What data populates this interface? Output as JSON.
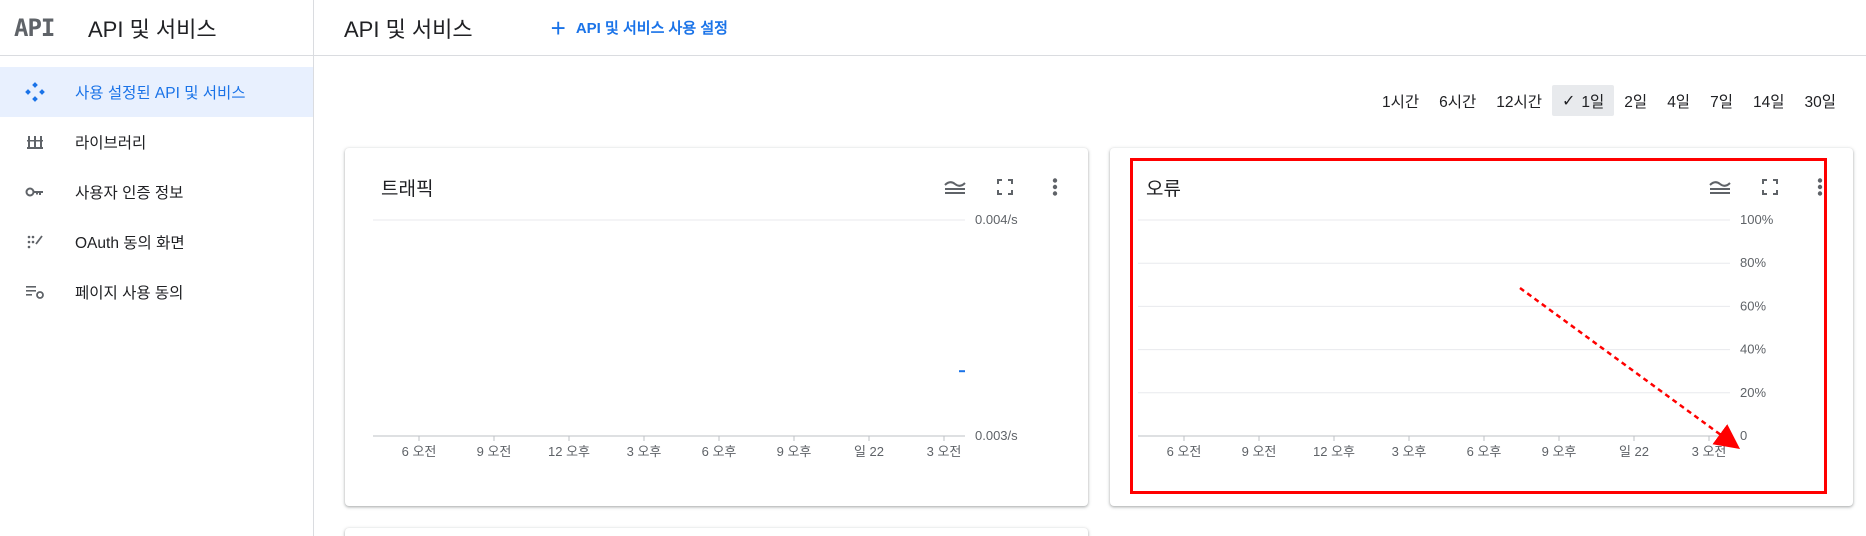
{
  "sidebar": {
    "logo": "API",
    "title": "API 및 서비스",
    "items": [
      {
        "label": "사용 설정된 API 및 서비스",
        "icon": "diamond-icon",
        "active": true
      },
      {
        "label": "라이브러리",
        "icon": "library-icon",
        "active": false
      },
      {
        "label": "사용자 인증 정보",
        "icon": "key-icon",
        "active": false
      },
      {
        "label": "OAuth 동의 화면",
        "icon": "consent-icon",
        "active": false
      },
      {
        "label": "페이지 사용 동의",
        "icon": "page-settings-icon",
        "active": false
      }
    ]
  },
  "header": {
    "title": "API 및 서비스",
    "enable_button": "API 및 서비스 사용 설정"
  },
  "time_range": {
    "options": [
      "1시간",
      "6시간",
      "12시간",
      "1일",
      "2일",
      "4일",
      "7일",
      "14일",
      "30일"
    ],
    "selected": "1일"
  },
  "colors": {
    "accent": "#1a73e8",
    "highlight": "#ff0000"
  },
  "cards": {
    "traffic": {
      "title": "트래픽"
    },
    "errors": {
      "title": "오류"
    }
  },
  "chart_data": [
    {
      "type": "line",
      "title": "트래픽",
      "x_ticks": [
        "6 오전",
        "9 오전",
        "12 오후",
        "3 오후",
        "6 오후",
        "9 오후",
        "일 22",
        "3 오전"
      ],
      "y_ticks": [
        "0.004/s",
        "0.003/s"
      ],
      "ylim": [
        0.003,
        0.004
      ],
      "series": [
        {
          "values": [
            {
              "x": "3 오전 +",
              "y": 0.0033
            }
          ]
        }
      ],
      "grid": true
    },
    {
      "type": "line",
      "title": "오류",
      "x_ticks": [
        "6 오전",
        "9 오전",
        "12 오후",
        "3 오후",
        "6 오후",
        "9 오후",
        "일 22",
        "3 오전"
      ],
      "y_ticks": [
        "100%",
        "80%",
        "60%",
        "40%",
        "20%",
        "0"
      ],
      "ylim": [
        0,
        100
      ],
      "series": [
        {
          "values": [
            {
              "x": "3 오전 +",
              "y": 0
            }
          ]
        }
      ],
      "grid": true
    }
  ]
}
